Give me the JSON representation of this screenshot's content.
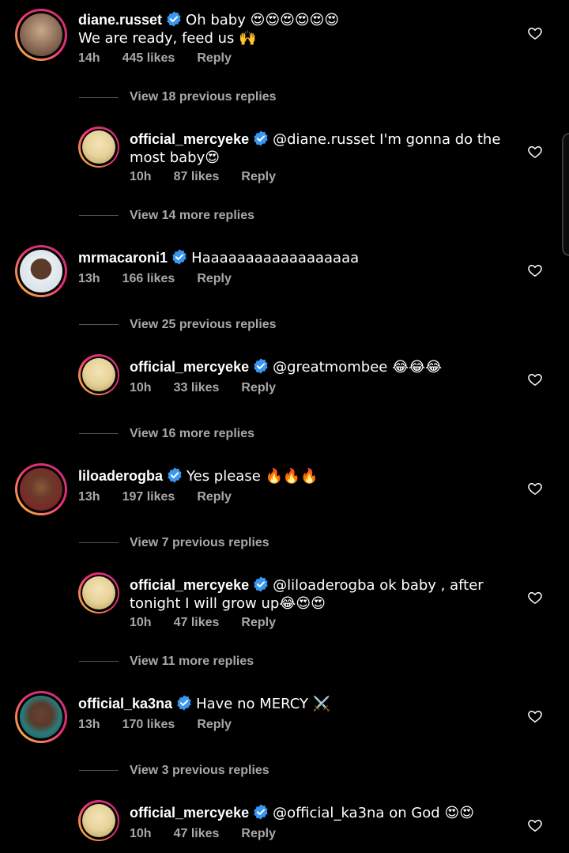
{
  "comments": [
    {
      "username": "diane.russet",
      "verified": true,
      "text_line1": "Oh baby 😍😍😍😍😍😍",
      "text_line2": "We are ready, feed us 🙌",
      "time": "14h",
      "likes": "445 likes",
      "reply_label": "Reply",
      "avatar_color": "#8a6a55"
    },
    {
      "view_text": "View 18 previous replies"
    },
    {
      "username": "official_mercyeke",
      "verified": true,
      "text": "@diane.russet I'm gonna do the most baby😍",
      "time": "10h",
      "likes": "87 likes",
      "reply_label": "Reply",
      "avatar_color": "#e6d29a"
    },
    {
      "view_text": "View 14 more replies"
    },
    {
      "username": "mrmacaroni1",
      "verified": true,
      "text": "Haaaaaaaaaaaaaaaaaa",
      "time": "13h",
      "likes": "166 likes",
      "reply_label": "Reply",
      "avatar_color": "#cfd8e0"
    },
    {
      "view_text": "View 25 previous replies"
    },
    {
      "username": "official_mercyeke",
      "verified": true,
      "text": "@greatmombee 😂😂😂",
      "time": "10h",
      "likes": "33 likes",
      "reply_label": "Reply",
      "avatar_color": "#e6d29a"
    },
    {
      "view_text": "View 16 more replies"
    },
    {
      "username": "liloaderogba",
      "verified": true,
      "text": "Yes please 🔥🔥🔥",
      "time": "13h",
      "likes": "197 likes",
      "reply_label": "Reply",
      "avatar_color": "#7a2a2a"
    },
    {
      "view_text": "View 7 previous replies"
    },
    {
      "username": "official_mercyeke",
      "verified": true,
      "text": "@liloaderogba ok baby , after tonight I will grow up😂😍😍",
      "time": "10h",
      "likes": "47 likes",
      "reply_label": "Reply",
      "avatar_color": "#e6d29a"
    },
    {
      "view_text": "View 11 more replies"
    },
    {
      "username": "official_ka3na",
      "verified": true,
      "text": "Have no MERCY ⚔️",
      "time": "13h",
      "likes": "170 likes",
      "reply_label": "Reply",
      "avatar_color": "#5a3a2a"
    },
    {
      "view_text": "View 3 previous replies"
    },
    {
      "username": "official_mercyeke",
      "verified": true,
      "text": "@official_ka3na on God 😍😍",
      "time": "10h",
      "likes": "47 likes",
      "reply_label": "Reply",
      "avatar_color": "#e6d29a"
    }
  ],
  "colors": {
    "background": "#000000",
    "text": "#ffffff",
    "secondary_text": "#a8a8a8",
    "verified_badge": "#3897f0",
    "story_ring_start": "#f9ce34",
    "story_ring_end": "#ee2a7b"
  },
  "icons": {
    "verified": "verified-badge-icon",
    "like": "heart-outline-icon"
  }
}
